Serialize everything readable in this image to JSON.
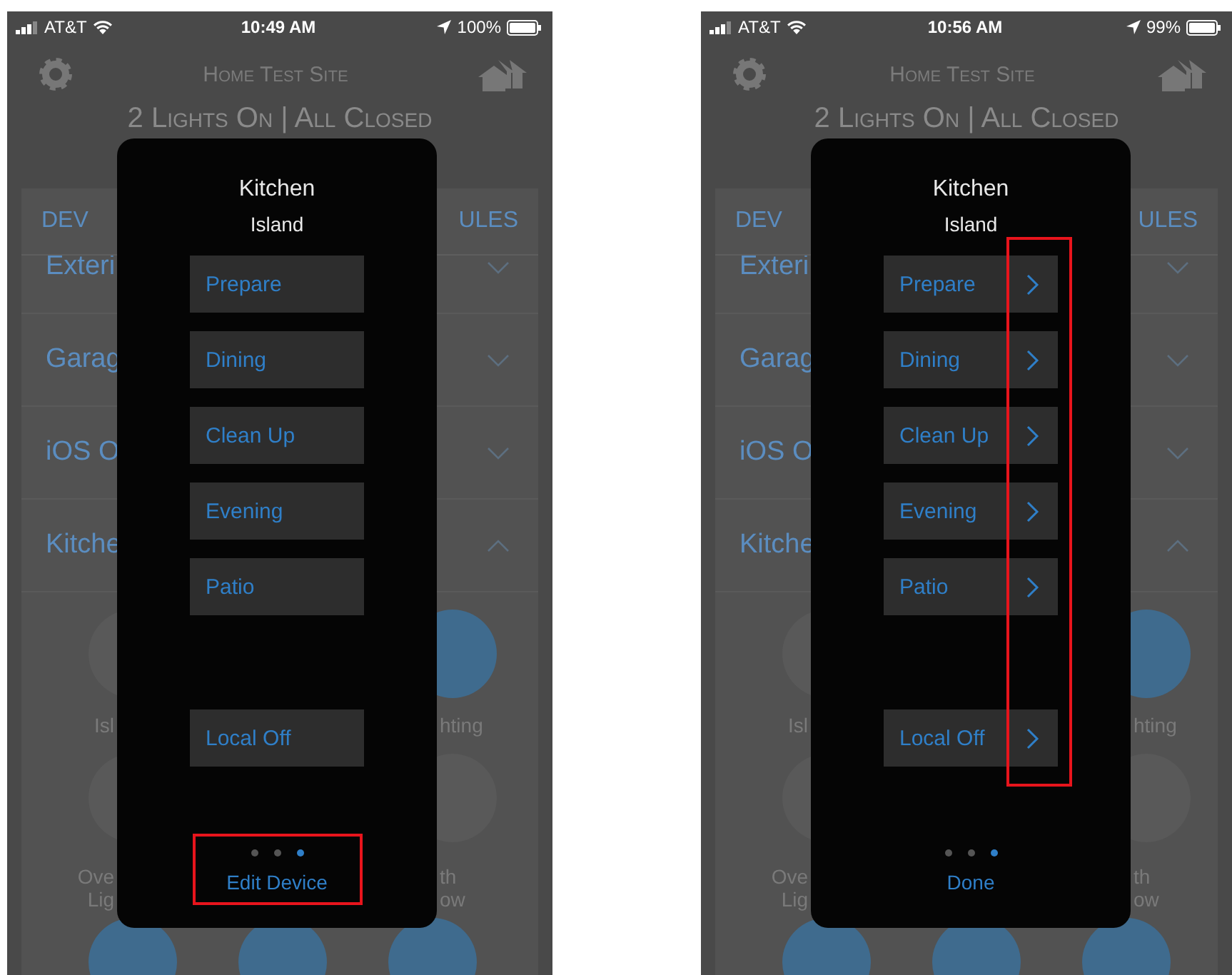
{
  "phones": [
    {
      "status_bar": {
        "carrier": "AT&T",
        "time": "10:49 AM",
        "battery": "100%"
      },
      "header": {
        "title": "Home Test Site"
      },
      "summary": "2 Lights On | All Closed",
      "tabs": [
        {
          "label": "DEV"
        },
        {
          "label": "ULES"
        }
      ],
      "rows": [
        {
          "label": "Exteri",
          "expanded": false
        },
        {
          "label": "Garag",
          "expanded": false
        },
        {
          "label": "iOS O",
          "expanded": false
        },
        {
          "label": "Kitche",
          "expanded": true
        }
      ],
      "tiles": [
        {
          "left": {
            "label_lines": [
              "Isl"
            ],
            "on": false
          },
          "right": {
            "label_lines": [
              "hting"
            ],
            "on": true
          }
        },
        {
          "left": {
            "label_lines": [
              "Ove",
              "Lig"
            ],
            "on": false
          },
          "right": {
            "label_lines": [
              "th",
              "ow"
            ],
            "on": false
          }
        }
      ],
      "bottom_tiles": [
        {
          "on": true
        },
        {
          "on": true
        },
        {
          "on": true
        }
      ],
      "dialog": {
        "title": "Kitchen",
        "subtitle": "Island",
        "scenes": [
          {
            "label": "Prepare"
          },
          {
            "label": "Dining"
          },
          {
            "label": "Clean Up"
          },
          {
            "label": "Evening"
          },
          {
            "label": "Patio"
          }
        ],
        "off_buttons": [
          {
            "label": "Local Off"
          }
        ],
        "show_chevrons": false,
        "page_dots": [
          {
            "selected": false
          },
          {
            "selected": false
          },
          {
            "selected": true
          }
        ],
        "action": "Edit Device"
      },
      "annotation": {
        "kind": "footer"
      }
    },
    {
      "status_bar": {
        "carrier": "AT&T",
        "time": "10:56 AM",
        "battery": "99%"
      },
      "header": {
        "title": "Home Test Site"
      },
      "summary": "2 Lights On | All Closed",
      "tabs": [
        {
          "label": "DEV"
        },
        {
          "label": "ULES"
        }
      ],
      "rows": [
        {
          "label": "Exteri",
          "expanded": false
        },
        {
          "label": "Garag",
          "expanded": false
        },
        {
          "label": "iOS O",
          "expanded": false
        },
        {
          "label": "Kitche",
          "expanded": true
        }
      ],
      "tiles": [
        {
          "left": {
            "label_lines": [
              "Isl"
            ],
            "on": false
          },
          "right": {
            "label_lines": [
              "hting"
            ],
            "on": true
          }
        },
        {
          "left": {
            "label_lines": [
              "Ove",
              "Lig"
            ],
            "on": false
          },
          "right": {
            "label_lines": [
              "th",
              "ow"
            ],
            "on": false
          }
        }
      ],
      "bottom_tiles": [
        {
          "on": true
        },
        {
          "on": true
        },
        {
          "on": true
        }
      ],
      "dialog": {
        "title": "Kitchen",
        "subtitle": "Island",
        "scenes": [
          {
            "label": "Prepare"
          },
          {
            "label": "Dining"
          },
          {
            "label": "Clean Up"
          },
          {
            "label": "Evening"
          },
          {
            "label": "Patio"
          }
        ],
        "off_buttons": [
          {
            "label": "Local Off"
          }
        ],
        "show_chevrons": true,
        "page_dots": [
          {
            "selected": false
          },
          {
            "selected": false
          },
          {
            "selected": true
          }
        ],
        "action": "Done"
      },
      "annotation": {
        "kind": "chevrons"
      }
    }
  ]
}
